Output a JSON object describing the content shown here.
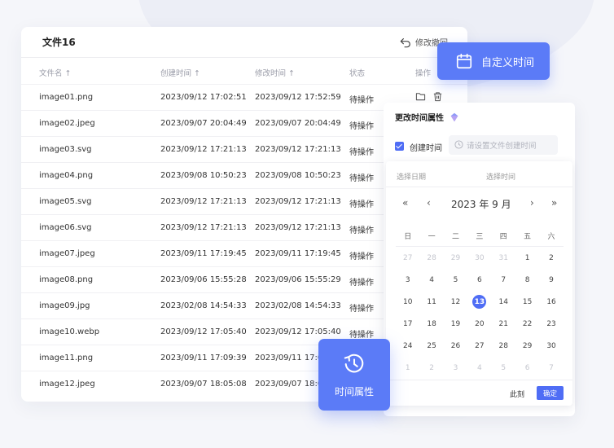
{
  "card": {
    "title": "文件16",
    "undo_label": "修改撤回"
  },
  "columns": {
    "name": "文件名 ↑",
    "created": "创建时间 ↑",
    "modified": "修改时间 ↑",
    "status": "状态",
    "action": "操作"
  },
  "rows": [
    {
      "name": "image01.png",
      "created": "2023/09/12 17:02:51",
      "modified": "2023/09/12 17:52:59",
      "status": "待操作"
    },
    {
      "name": "image02.jpeg",
      "created": "2023/09/07 20:04:49",
      "modified": "2023/09/07 20:04:49",
      "status": "待操作"
    },
    {
      "name": "image03.svg",
      "created": "2023/09/12 17:21:13",
      "modified": "2023/09/12 17:21:13",
      "status": "待操作"
    },
    {
      "name": "image04.png",
      "created": "2023/09/08 10:50:23",
      "modified": "2023/09/08 10:50:23",
      "status": "待操作"
    },
    {
      "name": "image05.svg",
      "created": "2023/09/12 17:21:13",
      "modified": "2023/09/12 17:21:13",
      "status": "待操作"
    },
    {
      "name": "image06.svg",
      "created": "2023/09/12 17:21:13",
      "modified": "2023/09/12 17:21:13",
      "status": "待操作"
    },
    {
      "name": "image07.jpeg",
      "created": "2023/09/11 17:19:45",
      "modified": "2023/09/11 17:19:45",
      "status": "待操作"
    },
    {
      "name": "image08.png",
      "created": "2023/09/06 15:55:28",
      "modified": "2023/09/06 15:55:29",
      "status": "待操作"
    },
    {
      "name": "image09.jpg",
      "created": "2023/02/08 14:54:33",
      "modified": "2023/02/08 14:54:33",
      "status": "待操作"
    },
    {
      "name": "image10.webp",
      "created": "2023/09/12 17:05:40",
      "modified": "2023/09/12 17:05:40",
      "status": "待操作"
    },
    {
      "name": "image11.png",
      "created": "2023/09/11 17:09:39",
      "modified": "2023/09/11 17:09",
      "status": ""
    },
    {
      "name": "image12.jpeg",
      "created": "2023/09/07 18:05:08",
      "modified": "2023/09/07 18:0",
      "status": ""
    }
  ],
  "badge_custom": {
    "label": "自定义时间"
  },
  "panel": {
    "title": "更改时间属性",
    "checkbox_label": "创建时间",
    "input_placeholder": "请设置文件创建时间",
    "tab_date": "选择日期",
    "tab_time": "选择时间",
    "month_label": "2023 年  9 月",
    "weekdays": [
      "日",
      "一",
      "二",
      "三",
      "四",
      "五",
      "六"
    ],
    "days": [
      {
        "n": "27",
        "o": true
      },
      {
        "n": "28",
        "o": true
      },
      {
        "n": "29",
        "o": true
      },
      {
        "n": "30",
        "o": true
      },
      {
        "n": "31",
        "o": true
      },
      {
        "n": "1"
      },
      {
        "n": "2"
      },
      {
        "n": "3"
      },
      {
        "n": "4"
      },
      {
        "n": "5"
      },
      {
        "n": "6"
      },
      {
        "n": "7"
      },
      {
        "n": "8"
      },
      {
        "n": "9"
      },
      {
        "n": "10"
      },
      {
        "n": "11"
      },
      {
        "n": "12"
      },
      {
        "n": "13",
        "sel": true
      },
      {
        "n": "14"
      },
      {
        "n": "15"
      },
      {
        "n": "16"
      },
      {
        "n": "17"
      },
      {
        "n": "18"
      },
      {
        "n": "19"
      },
      {
        "n": "20"
      },
      {
        "n": "21"
      },
      {
        "n": "22"
      },
      {
        "n": "23"
      },
      {
        "n": "24"
      },
      {
        "n": "25"
      },
      {
        "n": "26"
      },
      {
        "n": "27"
      },
      {
        "n": "28"
      },
      {
        "n": "29"
      },
      {
        "n": "30"
      },
      {
        "n": "1",
        "o": true
      },
      {
        "n": "2",
        "o": true
      },
      {
        "n": "3",
        "o": true
      },
      {
        "n": "4",
        "o": true
      },
      {
        "n": "5",
        "o": true
      },
      {
        "n": "6",
        "o": true
      },
      {
        "n": "7",
        "o": true
      }
    ],
    "now_label": "此刻",
    "ok_label": "确定"
  },
  "badge_time": {
    "label": "时间属性"
  },
  "accent_color": "#5b7bf7"
}
